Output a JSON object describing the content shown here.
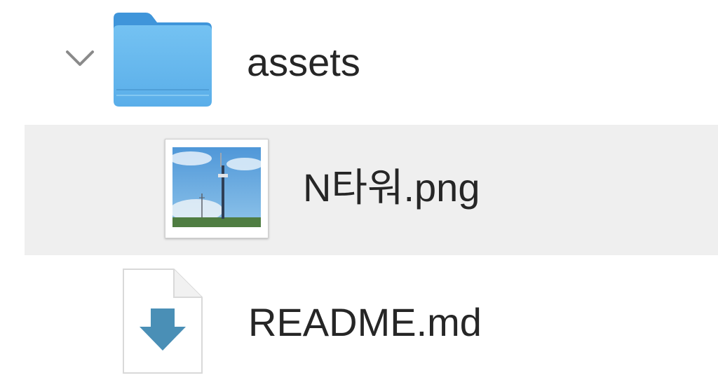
{
  "tree": {
    "folder": {
      "name": "assets",
      "expanded": true,
      "icon": "folder-icon",
      "toggle_icon": "chevron-down-icon"
    },
    "items": [
      {
        "name": "N타워.png",
        "icon": "image-thumbnail-icon",
        "selected": true
      },
      {
        "name": "README.md",
        "icon": "markdown-document-icon",
        "selected": false
      }
    ],
    "colors": {
      "folder": "#5fb3ec",
      "selection": "#efefef",
      "markdown_arrow": "#4a8fb6"
    }
  }
}
